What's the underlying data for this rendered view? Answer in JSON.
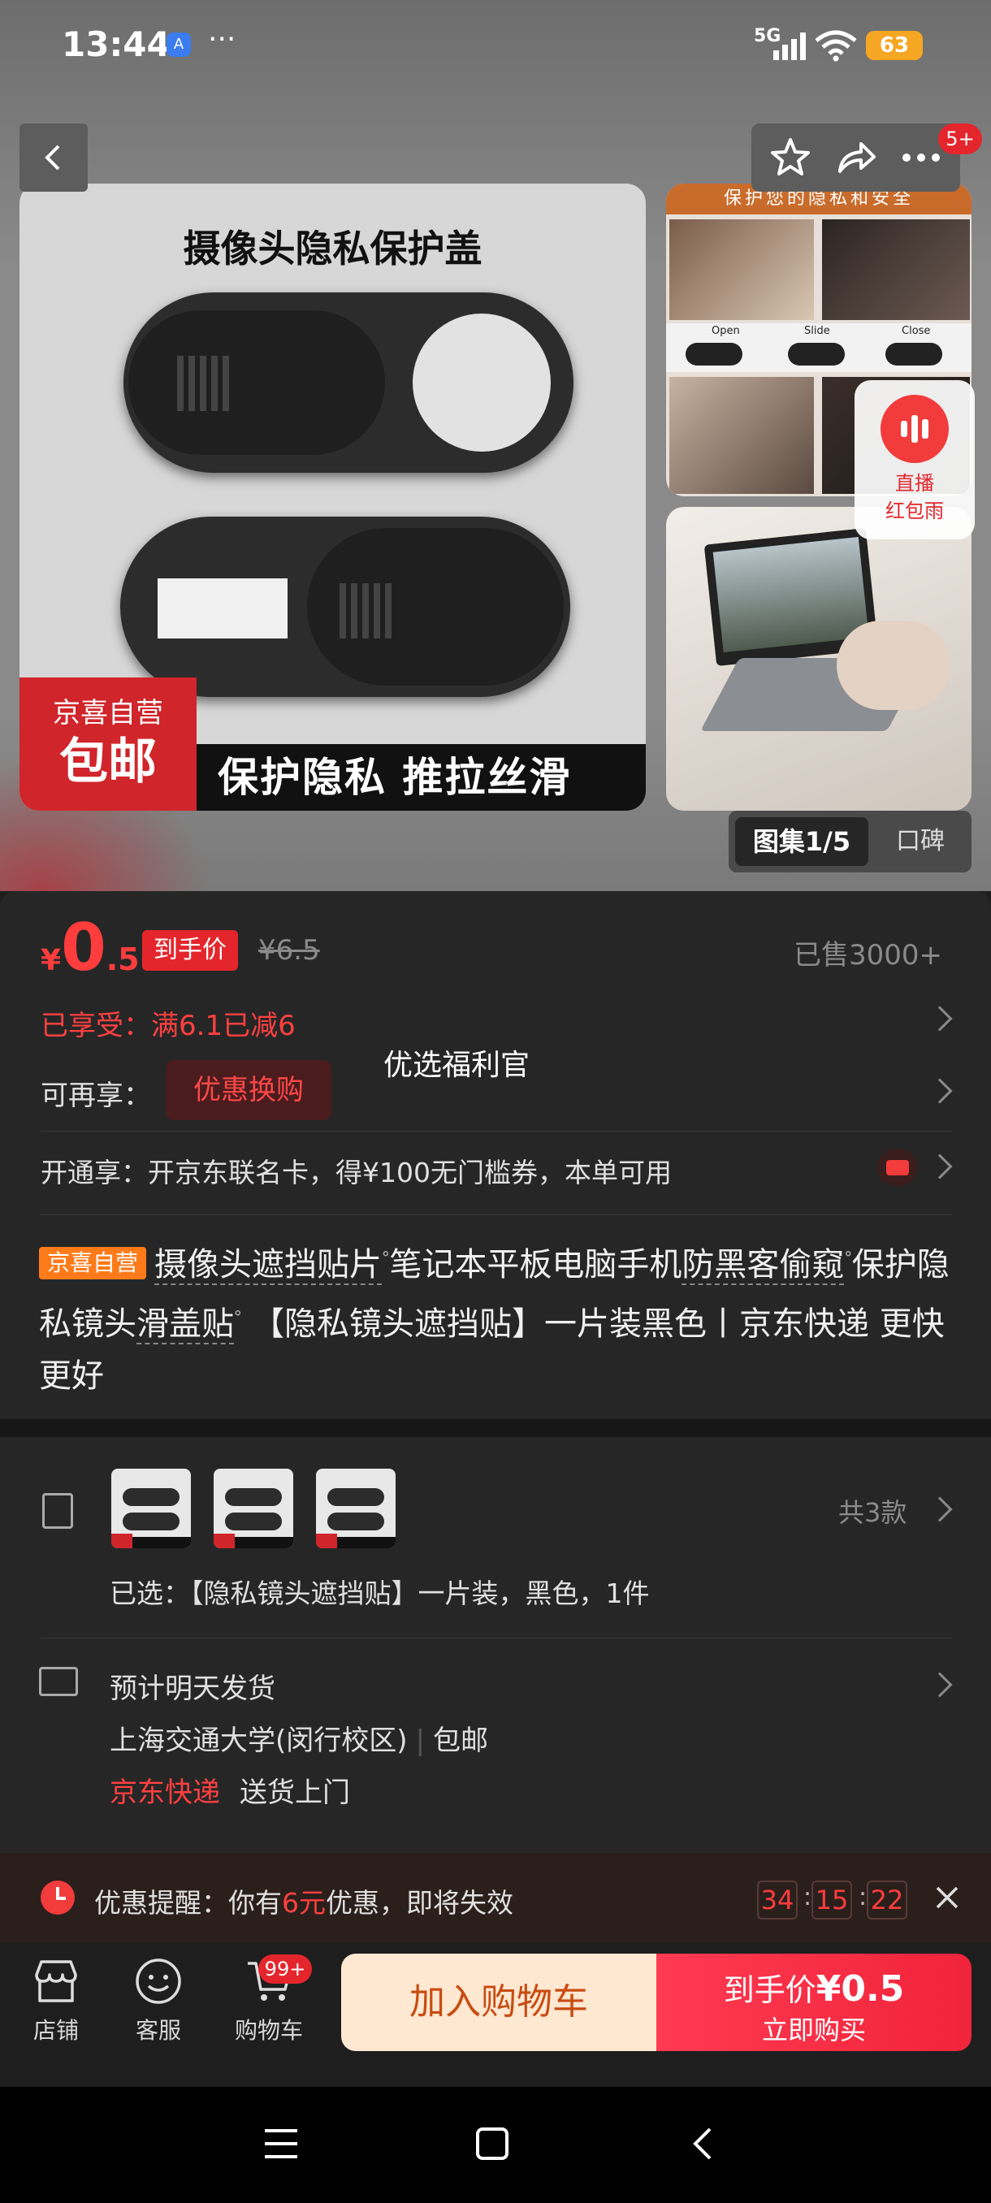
{
  "status_bar": {
    "time": "13:44",
    "app_badge": "A",
    "dots": "···",
    "network": "5G",
    "battery": "63"
  },
  "gallery": {
    "main_image_title": "摄像头隐私保护盖",
    "main_tag_line1": "京喜自营",
    "main_tag_line2": "包邮",
    "main_banner": "保护隐私 推拉丝滑",
    "thumb_header": "保护您的隐私和安全",
    "thumb_labels": [
      "Open",
      "Slide",
      "Close"
    ],
    "tab_active": "图集1/5",
    "tab_other": "口碑",
    "cart_badge": "5+",
    "live_label_1": "直播",
    "live_label_2": "红包雨"
  },
  "price": {
    "currency": "¥",
    "int": "0",
    "dec": ".5",
    "label": "到手价",
    "original": "¥6.5",
    "sold": "已售3000+"
  },
  "benefits": {
    "enjoyed_label": "已享受：",
    "enjoyed_value": "满6.1已减6",
    "more_label": "可再享：",
    "swap_button": "优惠换购",
    "fuli": "优选福利官",
    "open_label": "开通享：",
    "open_value": "开京东联名卡，得¥100无门槛券，本单可用"
  },
  "title": {
    "tag": "京喜自营",
    "seg1": "摄像头遮挡贴片",
    "seg2": "笔记本平板电脑手机",
    "seg3": "防黑客偷窥",
    "seg4": "保护隐私镜头",
    "seg5": "滑盖贴",
    "seg6": " 【隐私镜头遮挡贴】一片装黑色丨京东快递 更快更好"
  },
  "sku": {
    "count": "共3款",
    "selected": "已选：【隐私镜头遮挡贴】一片装，黑色，1件"
  },
  "shipping": {
    "eta": "预计明天发货",
    "address": "上海交通大学(闵行校区)",
    "free": "包邮",
    "carrier": "京东快递",
    "service": "送货上门"
  },
  "promo": {
    "prefix": "优惠提醒：你有",
    "amount": "6元",
    "suffix": "优惠，即将失效",
    "h": "34",
    "m": "15",
    "s": "22"
  },
  "bottom_bar": {
    "store": "店铺",
    "service": "客服",
    "cart": "购物车",
    "cart_badge": "99+",
    "add_cart": "加入购物车",
    "buy_line1_prefix": "到手价",
    "buy_line1_price": "¥0.5",
    "buy_line2": "立即购买"
  },
  "colors": {
    "accent_red": "#e4262c",
    "price_red": "#ff3d3d",
    "orange": "#ff7a18"
  }
}
